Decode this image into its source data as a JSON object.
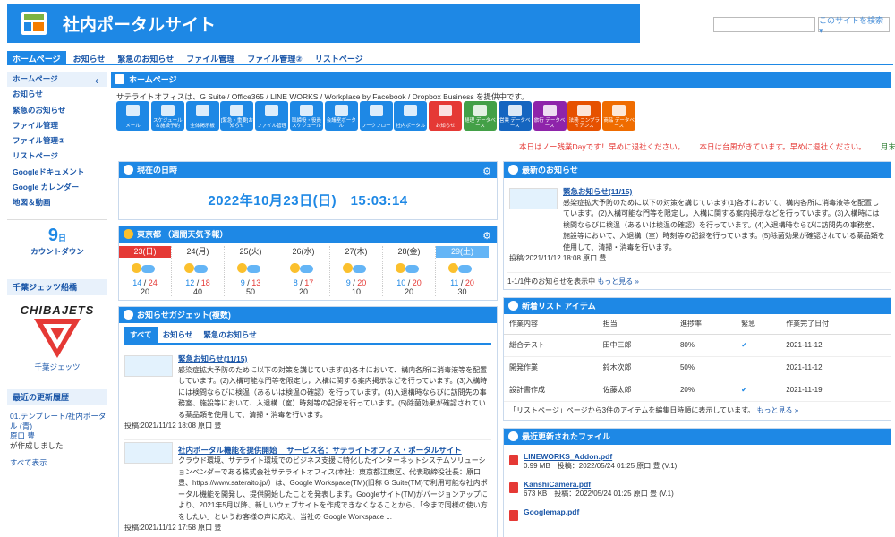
{
  "header": {
    "site_title": "社内ポータルサイト",
    "search_placeholder": "",
    "search_button": "このサイトを検索 ▾"
  },
  "nav": [
    "ホームページ",
    "お知らせ",
    "緊急のお知らせ",
    "ファイル管理",
    "ファイル管理②",
    "リストページ"
  ],
  "sidebar": {
    "items": [
      "ホームページ",
      "お知らせ",
      "緊急のお知らせ",
      "ファイル管理",
      "ファイル管理②",
      "リストページ",
      "Googleドキュメント",
      "Google カレンダー",
      "地図＆動画"
    ],
    "countdown_num": "9",
    "countdown_unit": "日",
    "countdown_label": "カウントダウン",
    "team_heading": "千葉ジェッツ船橋",
    "team_logo": "CHIBAJETS",
    "team_caption": "千葉ジェッツ",
    "updates_heading": "最近の更新履歴",
    "update_link": "01.テンプレート/社内ポータル (青)",
    "update_author": "原口 豊",
    "update_action": "が作成しました",
    "show_all": "すべて表示"
  },
  "home": {
    "heading": "ホームページ",
    "intro": "サテライトオフィスは、G Suite / Office365 / LINE WORKS / Workplace by Facebook / Dropbox Business を提供中です。",
    "icons": [
      {
        "label": "メール",
        "color": "#1e88e5"
      },
      {
        "label": "スケジュール＆施設予約",
        "color": "#1e88e5"
      },
      {
        "label": "全体掲示板",
        "color": "#1e88e5"
      },
      {
        "label": "[緊急・重要]お知らせ",
        "color": "#1e88e5"
      },
      {
        "label": "ファイル管理",
        "color": "#1e88e5"
      },
      {
        "label": "取締役・役員スケジュール",
        "color": "#1e88e5"
      },
      {
        "label": "会議室ポータル",
        "color": "#1e88e5"
      },
      {
        "label": "ワークフロー",
        "color": "#1e88e5"
      },
      {
        "label": "社内ポータル",
        "color": "#1e88e5"
      },
      {
        "label": "お知らせ",
        "color": "#e53935"
      },
      {
        "label": "経理 データベース",
        "color": "#43a047"
      },
      {
        "label": "営業 データベース",
        "color": "#1565c0"
      },
      {
        "label": "旅行 データベース",
        "color": "#8e24aa"
      },
      {
        "label": "法務 コンプライアンス",
        "color": "#e65100"
      },
      {
        "label": "商品 データベース",
        "color": "#ef6c00"
      }
    ],
    "marquee1": "本日はノー残業Dayです！早めに退社ください。",
    "marquee2": "本日は台風がきています。早めに退社ください。",
    "marquee3": "月末です"
  },
  "datetime": {
    "heading": "現在の日時",
    "value": "2022年10月23日(日)　15:03:14"
  },
  "weather": {
    "heading": "東京都 （週間天気予報）",
    "days": [
      {
        "date": "23(日)",
        "lo": "14",
        "hi": "24",
        "pr": "20"
      },
      {
        "date": "24(月)",
        "lo": "12",
        "hi": "18",
        "pr": "40"
      },
      {
        "date": "25(火)",
        "lo": "9",
        "hi": "13",
        "pr": "50"
      },
      {
        "date": "26(水)",
        "lo": "8",
        "hi": "17",
        "pr": "20"
      },
      {
        "date": "27(木)",
        "lo": "9",
        "hi": "20",
        "pr": "10"
      },
      {
        "date": "28(金)",
        "lo": "10",
        "hi": "20",
        "pr": "20"
      },
      {
        "date": "29(土)",
        "lo": "11",
        "hi": "20",
        "pr": "30"
      }
    ]
  },
  "gadget": {
    "heading": "お知らせガジェット(複数)",
    "tabs": [
      "すべて",
      "お知らせ",
      "緊急のお知らせ"
    ],
    "n1_title": "緊急お知らせ(11/15)",
    "n1_body": "感染症拡大予防のために以下の対策を講じています(1)各オにおいて、構内各所に消毒液等を配置しています。(2)入構可能な門等を限定し，入構に関する案内掲示などを行っています。(3)入構時には検問ならびに検温（あるいは検温の確認）を行っています。(4)入退構時ならびに訪問先の事務室、施設等において、入退構（室）時刻等の記録を行っています。(5)除菌効果が確認されている薬品類を使用して、清掃・消毒を行います。",
    "n1_meta": "投稿:2021/11/12 18:08 原口 豊",
    "n2_title": "社内ポータル機能を提供開始　 サービス名：サテライトオフィス・ポータルサイト",
    "n2_body": "クラウド環境、サテライト環境でのビジネス支援に特化したインターネットシステムソリューションベンダーである株式会社サテライトオフィス(本社：東京都江東区、代表取締役社長：原口 豊、https://www.sateraito.jp/）は、Google Workspace(TM)(旧称 G Suite(TM)で利用可能な社内ポータル機能を開発し、提供開始したことを発表します。Googleサイト(TM)がバージョンアップにより、2021年5月以降、新しいウェブサイトを作成できなくなることから、「今まで同様の使い方をしたい」というお客様の声に応え、当社の Google Workspace ...",
    "n2_meta": "投稿:2021/11/12 17:58 原口 豊"
  },
  "latest": {
    "heading": "最新のお知らせ",
    "title": "緊急お知らせ(11/15)",
    "body": "感染症拡大予防のために以下の対策を講じています(1)各オにおいて、構内各所に消毒液等を配置しています。(2)入構可能な門等を限定し，入構に関する案内掲示などを行っています。(3)入構時には検問ならびに検温（あるいは検温の確認）を行っています。(4)入退構時ならびに訪問先の事務室、施設等において、入退構（室）時刻等の記録を行っています。(5)除菌効果が確認されている薬品類を使用して、清掃・消毒を行います。",
    "meta": "投稿:2021/11/12 18:08 原口 豊",
    "footer_count": "1-1/1件のお知らせを表示中",
    "footer_more": "もっと見る »"
  },
  "newlist": {
    "heading": "新着リスト アイテム",
    "columns": [
      "作業内容",
      "担当",
      "進捗率",
      "緊急",
      "作業完了日付"
    ],
    "rows": [
      {
        "task": "総合テスト",
        "owner": "田中三郎",
        "progress": "80%",
        "urgent": "✔",
        "date": "2021-11-12"
      },
      {
        "task": "開発作業",
        "owner": "鈴木次郎",
        "progress": "50%",
        "urgent": "",
        "date": "2021-11-12"
      },
      {
        "task": "設計書作成",
        "owner": "佐藤太郎",
        "progress": "20%",
        "urgent": "✔",
        "date": "2021-11-19"
      }
    ],
    "footer": "「リストページ」ページから3件のアイテムを編集日時順に表示しています。",
    "footer_more": "もっと見る »"
  },
  "files": {
    "heading": "最近更新されたファイル",
    "items": [
      {
        "name": "LINEWORKS_Addon.pdf",
        "meta": "0.99 MB　投稿：2022/05/24 01:25 原口 豊 (V.1)"
      },
      {
        "name": "KanshiCamera.pdf",
        "meta": "673 KB　投稿：2022/05/24 01:25 原口 豊 (V.1)"
      },
      {
        "name": "Googlemap.pdf",
        "meta": ""
      }
    ]
  }
}
